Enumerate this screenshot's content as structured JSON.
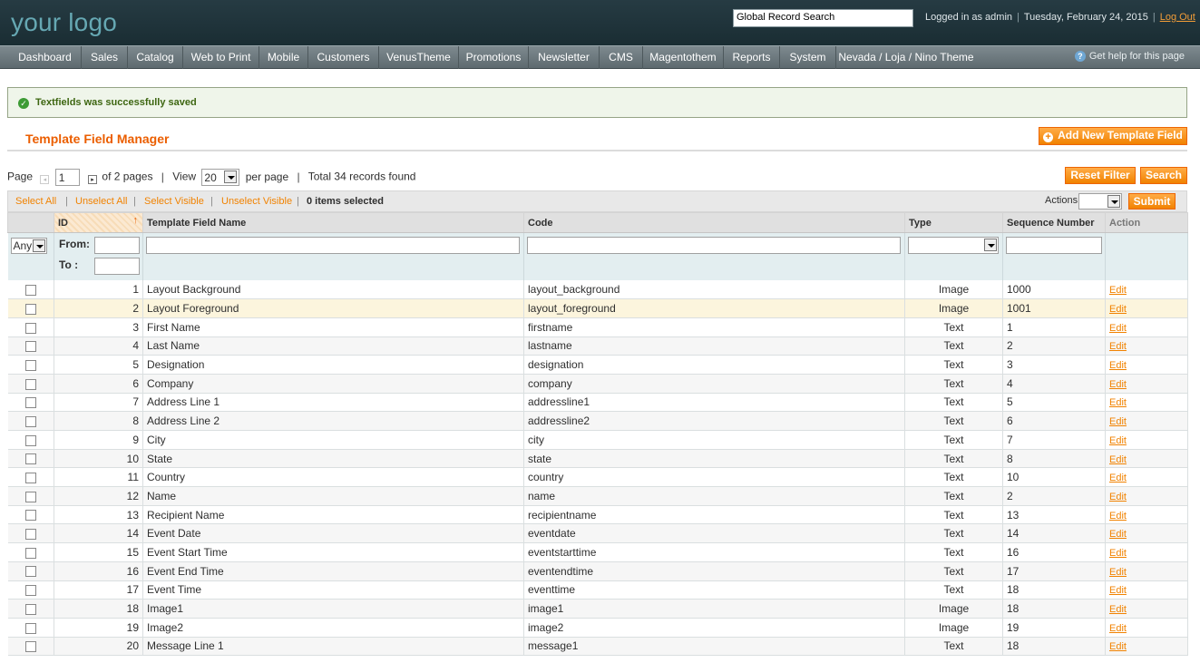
{
  "header": {
    "logo": "your logo",
    "global_search": "Global Record Search",
    "logged_in": "Logged in as admin",
    "date": "Tuesday, February 24, 2015",
    "logout": "Log Out"
  },
  "nav": {
    "items": [
      "Dashboard",
      "Sales",
      "Catalog",
      "Web to Print",
      "Mobile",
      "Customers",
      "VenusTheme",
      "Promotions",
      "Newsletter",
      "CMS",
      "Magentothem",
      "Reports",
      "System",
      "Nevada / Loja / Nino Theme"
    ],
    "help": "Get help for this page"
  },
  "message": "Textfields was successfully saved",
  "page_title": "Template Field Manager",
  "add_button": "Add New Template Field",
  "pager": {
    "page_label": "Page",
    "page_value": "1",
    "of_pages": "of 2 pages",
    "view_label": "View",
    "view_value": "20",
    "per_page": "per page",
    "total": "Total 34 records found"
  },
  "reset_filter": "Reset Filter",
  "search": "Search",
  "massaction": {
    "select_all": "Select All",
    "unselect_all": "Unselect All",
    "select_visible": "Select Visible",
    "unselect_visible": "Unselect Visible",
    "selected": "0 items selected",
    "actions_label": "Actions",
    "submit": "Submit"
  },
  "columns": [
    "ID",
    "Template Field Name",
    "Code",
    "Type",
    "Sequence Number",
    "Action"
  ],
  "filter": {
    "any": "Any",
    "from": "From:",
    "to": "To :"
  },
  "rows": [
    {
      "id": "1",
      "name": "Layout Background",
      "code": "layout_background",
      "type": "Image",
      "seq": "1000",
      "action": "Edit"
    },
    {
      "id": "2",
      "name": "Layout Foreground",
      "code": "layout_foreground",
      "type": "Image",
      "seq": "1001",
      "action": "Edit"
    },
    {
      "id": "3",
      "name": "First Name",
      "code": "firstname",
      "type": "Text",
      "seq": "1",
      "action": "Edit"
    },
    {
      "id": "4",
      "name": "Last Name",
      "code": "lastname",
      "type": "Text",
      "seq": "2",
      "action": "Edit"
    },
    {
      "id": "5",
      "name": "Designation",
      "code": "designation",
      "type": "Text",
      "seq": "3",
      "action": "Edit"
    },
    {
      "id": "6",
      "name": "Company",
      "code": "company",
      "type": "Text",
      "seq": "4",
      "action": "Edit"
    },
    {
      "id": "7",
      "name": "Address Line 1",
      "code": "addressline1",
      "type": "Text",
      "seq": "5",
      "action": "Edit"
    },
    {
      "id": "8",
      "name": "Address Line 2",
      "code": "addressline2",
      "type": "Text",
      "seq": "6",
      "action": "Edit"
    },
    {
      "id": "9",
      "name": "City",
      "code": "city",
      "type": "Text",
      "seq": "7",
      "action": "Edit"
    },
    {
      "id": "10",
      "name": "State",
      "code": "state",
      "type": "Text",
      "seq": "8",
      "action": "Edit"
    },
    {
      "id": "11",
      "name": "Country",
      "code": "country",
      "type": "Text",
      "seq": "10",
      "action": "Edit"
    },
    {
      "id": "12",
      "name": "Name",
      "code": "name",
      "type": "Text",
      "seq": "2",
      "action": "Edit"
    },
    {
      "id": "13",
      "name": "Recipient Name",
      "code": "recipientname",
      "type": "Text",
      "seq": "13",
      "action": "Edit"
    },
    {
      "id": "14",
      "name": "Event Date",
      "code": "eventdate",
      "type": "Text",
      "seq": "14",
      "action": "Edit"
    },
    {
      "id": "15",
      "name": "Event Start Time",
      "code": "eventstarttime",
      "type": "Text",
      "seq": "16",
      "action": "Edit"
    },
    {
      "id": "16",
      "name": "Event End Time",
      "code": "eventendtime",
      "type": "Text",
      "seq": "17",
      "action": "Edit"
    },
    {
      "id": "17",
      "name": "Event Time",
      "code": "eventtime",
      "type": "Text",
      "seq": "18",
      "action": "Edit"
    },
    {
      "id": "18",
      "name": "Image1",
      "code": "image1",
      "type": "Image",
      "seq": "18",
      "action": "Edit"
    },
    {
      "id": "19",
      "name": "Image2",
      "code": "image2",
      "type": "Image",
      "seq": "19",
      "action": "Edit"
    },
    {
      "id": "20",
      "name": "Message Line 1",
      "code": "message1",
      "type": "Text",
      "seq": "18",
      "action": "Edit"
    }
  ]
}
